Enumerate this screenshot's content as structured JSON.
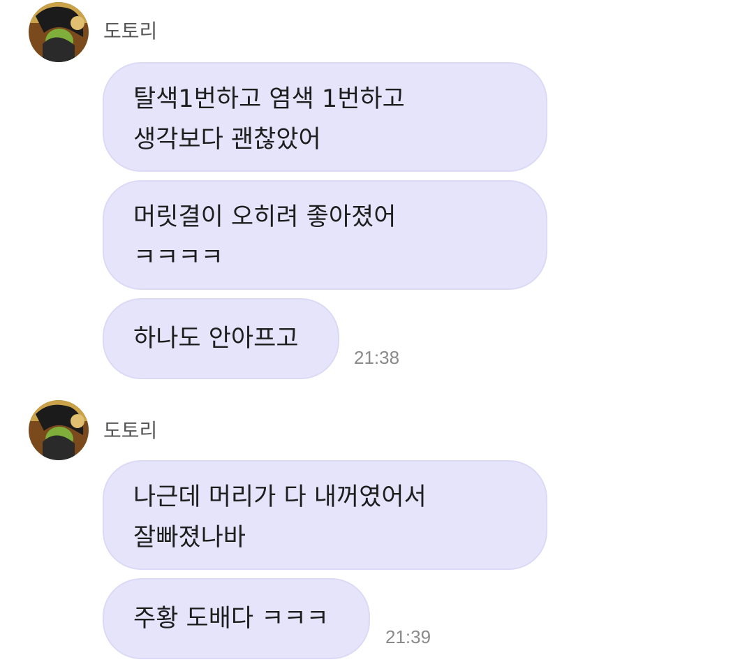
{
  "groups": [
    {
      "sender": "도토리",
      "messages": [
        {
          "lines": [
            "탈색1번하고 염색 1번하고",
            "생각보다  괜찮았어"
          ]
        },
        {
          "lines": [
            "머릿결이 오히려 좋아졌어",
            "ㅋㅋㅋㅋ"
          ]
        },
        {
          "lines": [
            "하나도 안아프고"
          ]
        }
      ],
      "time": "21:38"
    },
    {
      "sender": "도토리",
      "messages": [
        {
          "lines": [
            "나근데 머리가 다 내꺼였어서",
            "잘빠졌나바"
          ]
        },
        {
          "lines": [
            "주황 도배다 ㅋㅋㅋ"
          ]
        }
      ],
      "time": "21:39"
    }
  ],
  "colors": {
    "bubble": "#e6e4fb",
    "bubble_border": "#dcd9f6",
    "text": "#1e1e1e",
    "sender": "#555555",
    "time": "#8a8a8a"
  }
}
